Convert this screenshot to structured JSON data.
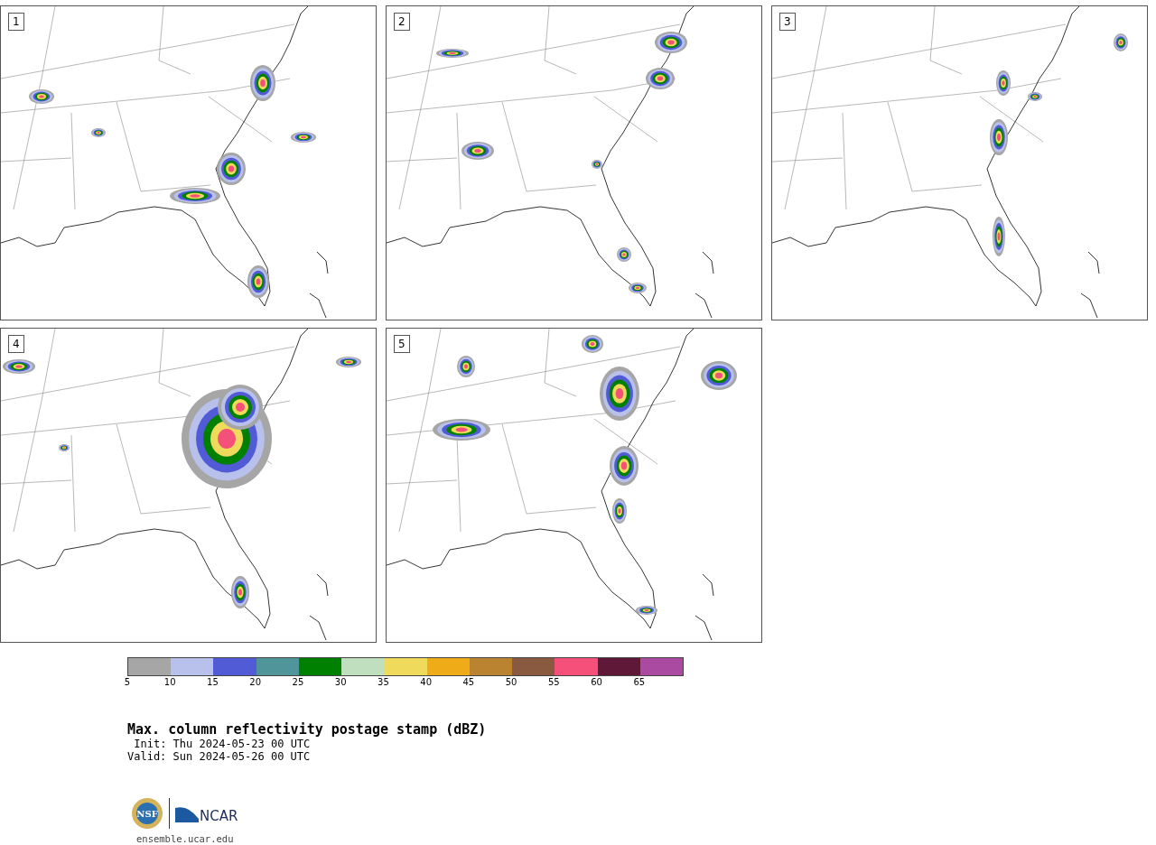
{
  "panels": [
    {
      "label": "1"
    },
    {
      "label": "2"
    },
    {
      "label": "3"
    },
    {
      "label": "4"
    },
    {
      "label": "5"
    }
  ],
  "colorbar": {
    "segments": [
      {
        "color": "#a6a6a6"
      },
      {
        "color": "#b8c1ec"
      },
      {
        "color": "#525bd6"
      },
      {
        "color": "#4f959a"
      },
      {
        "color": "#008000"
      },
      {
        "color": "#bfdfbf"
      },
      {
        "color": "#efda5b"
      },
      {
        "color": "#efac18"
      },
      {
        "color": "#b9832f"
      },
      {
        "color": "#895a3f"
      },
      {
        "color": "#f45079"
      },
      {
        "color": "#601838"
      },
      {
        "color": "#ab4aa1"
      }
    ],
    "ticks": [
      "5",
      "10",
      "15",
      "20",
      "25",
      "30",
      "35",
      "40",
      "45",
      "50",
      "55",
      "60",
      "65"
    ]
  },
  "title": "Max. column reflectivity postage stamp (dBZ)",
  "init": "Init: Thu 2024-05-23 00 UTC",
  "valid": "Valid: Sun 2024-05-26 00 UTC",
  "logo": {
    "left": "NSF",
    "right": "NCAR"
  },
  "url": "ensemble.ucar.edu"
}
